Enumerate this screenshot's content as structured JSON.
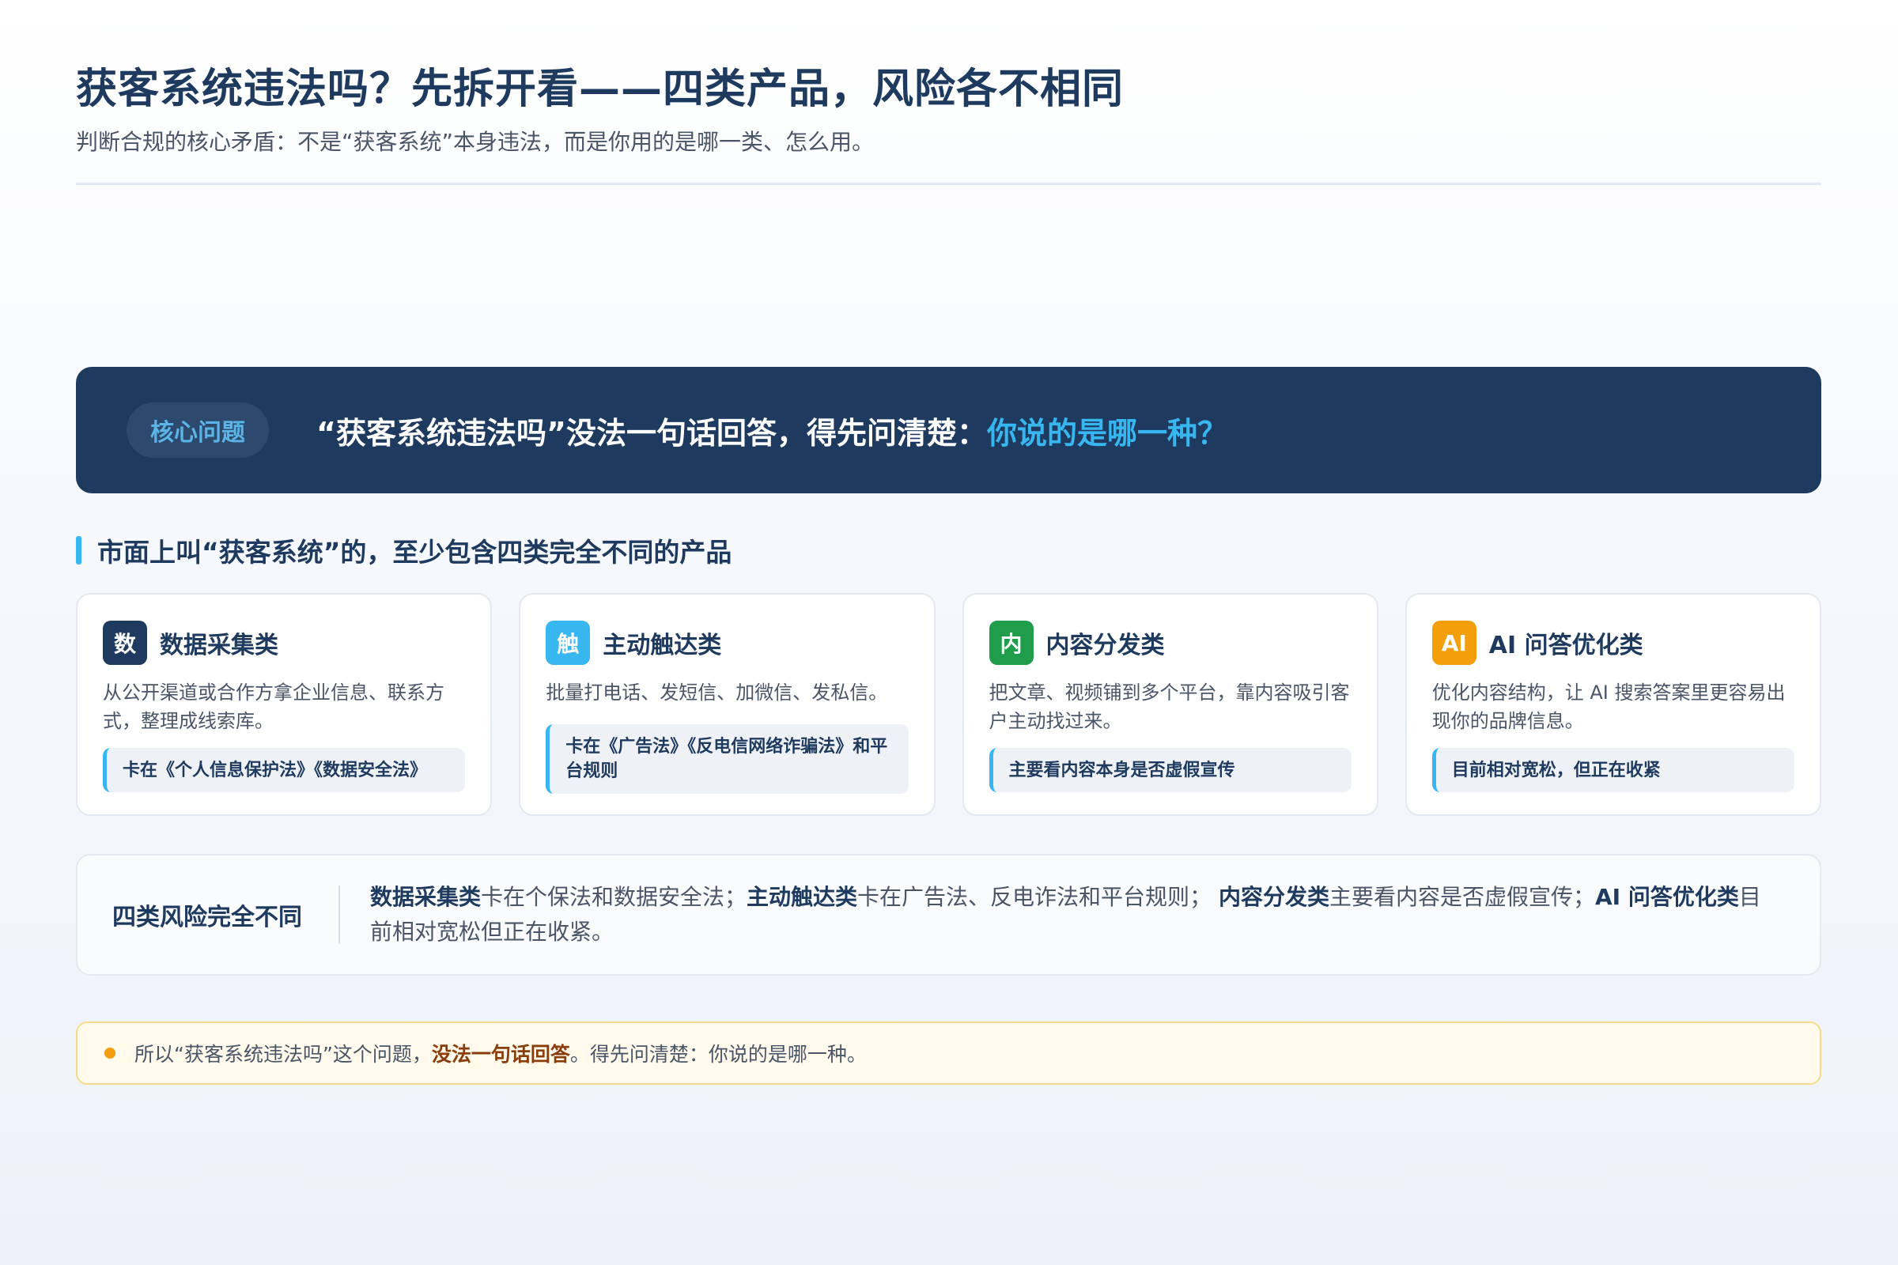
{
  "header": {
    "title": "获客系统违法吗？先拆开看——四类产品，风险各不相同",
    "subtitle": "判断合规的核心矛盾：不是“获客系统”本身违法，而是你用的是哪一类、怎么用。"
  },
  "banner": {
    "tag": "核心问题",
    "text": "“获客系统违法吗”没法一句话回答，得先问清楚：",
    "highlight": "你说的是哪一种？"
  },
  "section": {
    "title": "市面上叫“获客系统”的，至少包含四类完全不同的产品"
  },
  "cards": [
    {
      "icon": "数",
      "icon_color": "#1e3a5f",
      "title": "数据采集类",
      "desc": "从公开渠道或合作方拿企业信息、联系方式，整理成线索库。",
      "note": "卡在《个人信息保护法》《数据安全法》"
    },
    {
      "icon": "触",
      "icon_color": "#38b6f0",
      "title": "主动触达类",
      "desc": "批量打电话、发短信、加微信、发私信。",
      "note": "卡在《广告法》《反电信网络诈骗法》和平台规则"
    },
    {
      "icon": "内",
      "icon_color": "#1f9d4a",
      "title": "内容分发类",
      "desc": "把文章、视频铺到多个平台，靠内容吸引客户主动找过来。",
      "note": "主要看内容本身是否虚假宣传"
    },
    {
      "icon": "AI",
      "icon_color": "#f59e0b",
      "title": "AI 问答优化类",
      "desc": "优化内容结构，让 AI 搜索答案里更容易出现你的品牌信息。",
      "note": "目前相对宽松，但正在收紧"
    }
  ],
  "summary": {
    "label": "四类风险完全不同",
    "parts": [
      {
        "strong": "数据采集类",
        "text": "卡在个保法和数据安全法；"
      },
      {
        "strong": "主动触达类",
        "text": "卡在广告法、反电诈法和平台规则； "
      },
      {
        "strong": "内容分发类",
        "text": "主要看内容是否虚假宣传；"
      },
      {
        "strong": "AI 问答优化类",
        "text": "目前相对宽松但正在收紧。"
      }
    ]
  },
  "callout": {
    "before": "所以“获客系统违法吗”这个问题，",
    "strong": "没法一句话回答",
    "after": "。得先问清楚：你说的是哪一种。"
  }
}
